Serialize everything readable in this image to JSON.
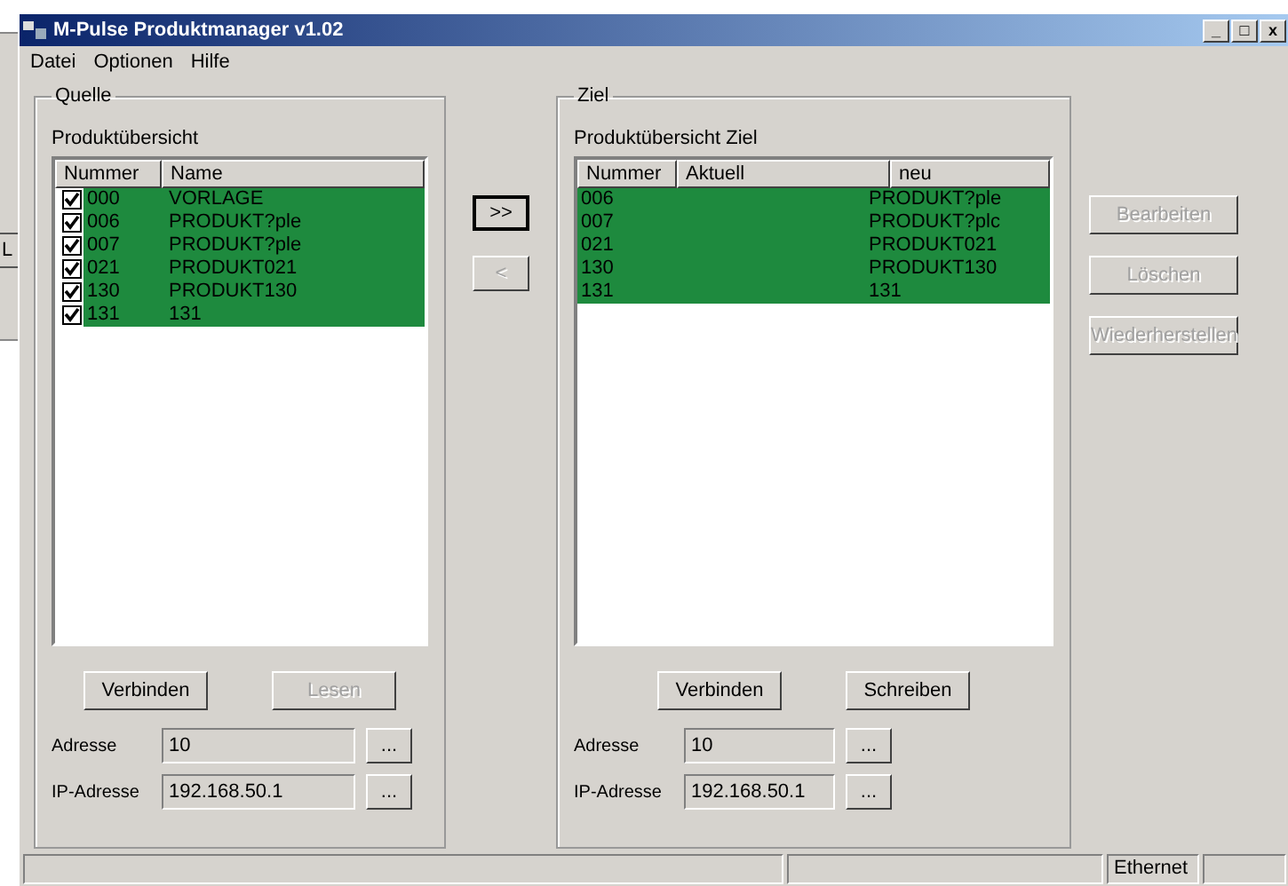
{
  "background_window": {
    "button": "L"
  },
  "window": {
    "title": "M-Pulse Produktmanager v1.02",
    "controls": [
      "_",
      "□",
      "x"
    ]
  },
  "menu": [
    "Datei",
    "Optionen",
    "Hilfe"
  ],
  "source": {
    "title": "Quelle",
    "list_label": "Produktübersicht",
    "columns": [
      "Nummer",
      "Name"
    ],
    "rows": [
      {
        "checked": true,
        "selected": true,
        "cells": [
          "000",
          "VORLAGE"
        ]
      },
      {
        "checked": true,
        "selected": true,
        "cells": [
          "006",
          "PRODUKT?ple"
        ]
      },
      {
        "checked": true,
        "selected": true,
        "cells": [
          "007",
          "PRODUKT?ple"
        ]
      },
      {
        "checked": true,
        "selected": true,
        "cells": [
          "021",
          "PRODUKT021"
        ]
      },
      {
        "checked": true,
        "selected": true,
        "cells": [
          "130",
          "PRODUKT130"
        ]
      },
      {
        "checked": true,
        "selected": true,
        "cells": [
          "131",
          "131"
        ]
      }
    ],
    "buttons": [
      {
        "label": "Verbinden",
        "disabled": false
      },
      {
        "label": "Lesen",
        "disabled": true
      }
    ],
    "fields": [
      {
        "label": "Adresse",
        "value": "10",
        "button": "..."
      },
      {
        "label": "IP-Adresse",
        "value": "192.168.50.1",
        "button": "..."
      }
    ]
  },
  "transfer_buttons": [
    {
      "label": ">>",
      "disabled": false
    },
    {
      "label": "<",
      "disabled": true
    }
  ],
  "target": {
    "title": "Ziel",
    "list_label": "Produktübersicht Ziel",
    "columns": [
      "Nummer",
      "Aktuell",
      "neu"
    ],
    "rows": [
      {
        "selected": true,
        "number": "006",
        "new": "PRODUKT?ple"
      },
      {
        "selected": true,
        "number": "007",
        "new": "PRODUKT?plc"
      },
      {
        "selected": true,
        "number": "021",
        "new": "PRODUKT021"
      },
      {
        "selected": true,
        "number": "130",
        "new": "PRODUKT130"
      },
      {
        "selected": true,
        "number": "131",
        "new": "131"
      }
    ],
    "buttons": [
      {
        "label": "Verbinden",
        "disabled": false
      },
      {
        "label": "Schreiben",
        "disabled": false
      }
    ],
    "fields": [
      {
        "label": "Adresse",
        "value": "10",
        "button": "..."
      },
      {
        "label": "IP-Adresse",
        "value": "192.168.50.1",
        "button": "..."
      }
    ]
  },
  "side_buttons": [
    {
      "label": "Bearbeiten",
      "disabled": true
    },
    {
      "label": "Löschen",
      "disabled": true
    },
    {
      "label": "Wiederherstellen",
      "disabled": true
    }
  ],
  "status_bar": {
    "connection": "Ethernet"
  }
}
